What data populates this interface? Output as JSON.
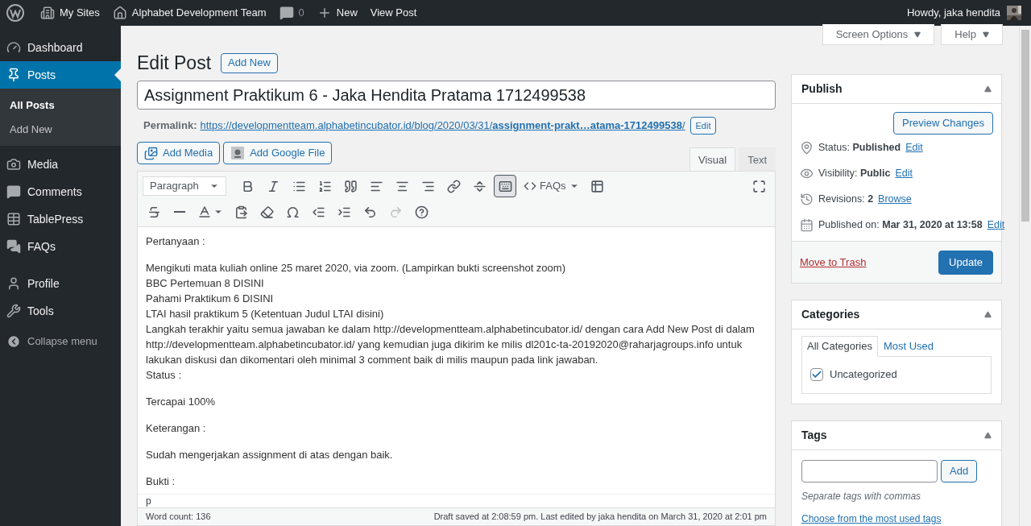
{
  "admin_bar": {
    "items": [
      {
        "kind": "logo"
      },
      {
        "kind": "sites",
        "label": "My Sites"
      },
      {
        "kind": "home",
        "label": "Alphabet Development Team"
      },
      {
        "kind": "comments",
        "label": "0"
      },
      {
        "kind": "new",
        "label": "New"
      },
      {
        "kind": "view",
        "label": "View Post"
      }
    ],
    "greeting": "Howdy, jaka hendita"
  },
  "sidebar": {
    "items": [
      {
        "kind": "dashboard",
        "label": "Dashboard",
        "selected": false
      },
      {
        "kind": "posts",
        "label": "Posts",
        "selected": true,
        "children": [
          {
            "label": "All Posts",
            "selected": true
          },
          {
            "label": "Add New",
            "selected": false
          }
        ]
      },
      {
        "kind": "media",
        "label": "Media",
        "selected": false
      },
      {
        "kind": "comments",
        "label": "Comments",
        "selected": false
      },
      {
        "kind": "table",
        "label": "TablePress",
        "selected": false
      },
      {
        "kind": "faqs",
        "label": "FAQs",
        "selected": false
      },
      {
        "kind": "profile",
        "label": "Profile",
        "selected": false
      },
      {
        "kind": "tools",
        "label": "Tools",
        "selected": false
      }
    ],
    "collapse": "Collapse menu"
  },
  "screen_tabs": [
    "Screen Options",
    "Help"
  ],
  "page_title": "Edit Post",
  "add_new": "Add New",
  "post_title": "Assignment Praktikum 6 - Jaka Hendita Pratama 1712499538",
  "permalink": {
    "label": "Permalink:",
    "url_start": "https://developmentteam.alphabetincubator.id/blog/2020/03/31/",
    "url_slug": "assignment-prakt…atama-1712499538",
    "url_end": "/",
    "edit": "Edit"
  },
  "media_buttons": [
    {
      "kind": "media",
      "label": "Add Media"
    },
    {
      "kind": "google",
      "label": "Add Google File"
    }
  ],
  "editor_tabs": [
    {
      "label": "Visual",
      "selected": true
    },
    {
      "label": "Text",
      "selected": false
    }
  ],
  "toolbar": [
    [
      {
        "kind": "format",
        "value": "Paragraph"
      },
      {
        "kind": "bold",
        "pressed": false,
        "disabled": false
      },
      {
        "kind": "italic",
        "pressed": false,
        "disabled": false
      },
      {
        "kind": "bullets",
        "pressed": false,
        "disabled": false
      },
      {
        "kind": "numbers",
        "pressed": false,
        "disabled": false
      },
      {
        "kind": "quote",
        "pressed": false,
        "disabled": false
      },
      {
        "kind": "align-left",
        "pressed": false,
        "disabled": false
      },
      {
        "kind": "align-center",
        "pressed": false,
        "disabled": false
      },
      {
        "kind": "align-right",
        "pressed": false,
        "disabled": false
      },
      {
        "kind": "link",
        "pressed": false,
        "disabled": false
      },
      {
        "kind": "more",
        "pressed": false,
        "disabled": false
      },
      {
        "kind": "kitchen-sink",
        "pressed": true,
        "disabled": false
      },
      {
        "kind": "faqs",
        "label": "FAQs",
        "pressed": false,
        "disabled": false
      },
      {
        "kind": "table",
        "pressed": false,
        "disabled": false
      },
      {
        "kind": "fullscreen",
        "pressed": false,
        "disabled": false
      }
    ],
    [
      {
        "kind": "strike",
        "pressed": false,
        "disabled": false
      },
      {
        "kind": "hr",
        "pressed": false,
        "disabled": false
      },
      {
        "kind": "text-color",
        "pressed": false,
        "disabled": false
      },
      {
        "kind": "paste-text",
        "pressed": false,
        "disabled": false
      },
      {
        "kind": "clear",
        "pressed": false,
        "disabled": false
      },
      {
        "kind": "omega",
        "pressed": false,
        "disabled": false
      },
      {
        "kind": "outdent",
        "pressed": false,
        "disabled": false
      },
      {
        "kind": "indent",
        "pressed": false,
        "disabled": false
      },
      {
        "kind": "undo",
        "pressed": false,
        "disabled": false
      },
      {
        "kind": "redo",
        "pressed": false,
        "disabled": true
      },
      {
        "kind": "help",
        "pressed": false,
        "disabled": false
      }
    ]
  ],
  "content": [
    {
      "lines": [
        "Pertanyaan :"
      ]
    },
    {
      "lines": [
        "Mengikuti mata kuliah online 25 maret 2020, via zoom. (Lampirkan bukti screenshot zoom)",
        "BBC Pertemuan 8 DISINI",
        "Pahami Praktikum 6 DISINI",
        "LTAI hasil praktikum 5 (Ketentuan Judul LTAI disini)",
        "Langkah terakhir yaitu semua jawaban ke dalam http://developmentteam.alphabetincubator.id/ dengan cara Add New Post di dalam http://developmentteam.alphabetincubator.id/ yang kemudian juga dikirim ke milis dl201c-ta-20192020@raharjagroups.info untuk lakukan diskusi dan dikomentari oleh minimal 3 comment baik di milis maupun pada link jawaban.",
        "Status :"
      ]
    },
    {
      "lines": [
        "Tercapai 100%"
      ]
    },
    {
      "lines": [
        "Keterangan :"
      ]
    },
    {
      "lines": [
        "Sudah mengerjakan assignment di atas dengan baik."
      ]
    },
    {
      "lines": [
        "Bukti :"
      ]
    }
  ],
  "path": "p",
  "word_count": "Word count: 136",
  "draft_status": "Draft saved at 2:08:59 pm. Last edited by jaka hendita on March 31, 2020 at 2:01 pm",
  "publish": {
    "title": "Publish",
    "preview": "Preview Changes",
    "rows": [
      {
        "kind": "status",
        "label": "Status:",
        "value": "Published",
        "link": "Edit"
      },
      {
        "kind": "visibility",
        "label": "Visibility:",
        "value": "Public",
        "link": "Edit"
      },
      {
        "kind": "revisions",
        "label": "Revisions:",
        "value": "2",
        "link": "Browse"
      },
      {
        "kind": "date",
        "label": "Published on:",
        "value": "Mar 31, 2020 at 13:58",
        "link": "Edit"
      }
    ],
    "trash": "Move to Trash",
    "update": "Update"
  },
  "categories": {
    "title": "Categories",
    "tabs": [
      {
        "label": "All Categories",
        "selected": true
      },
      {
        "label": "Most Used",
        "selected": false
      }
    ],
    "items": [
      {
        "label": "Uncategorized",
        "checked": true
      }
    ]
  },
  "tags": {
    "title": "Tags",
    "add": "Add",
    "hint": "Separate tags with commas",
    "choose": "Choose from the most used tags"
  }
}
